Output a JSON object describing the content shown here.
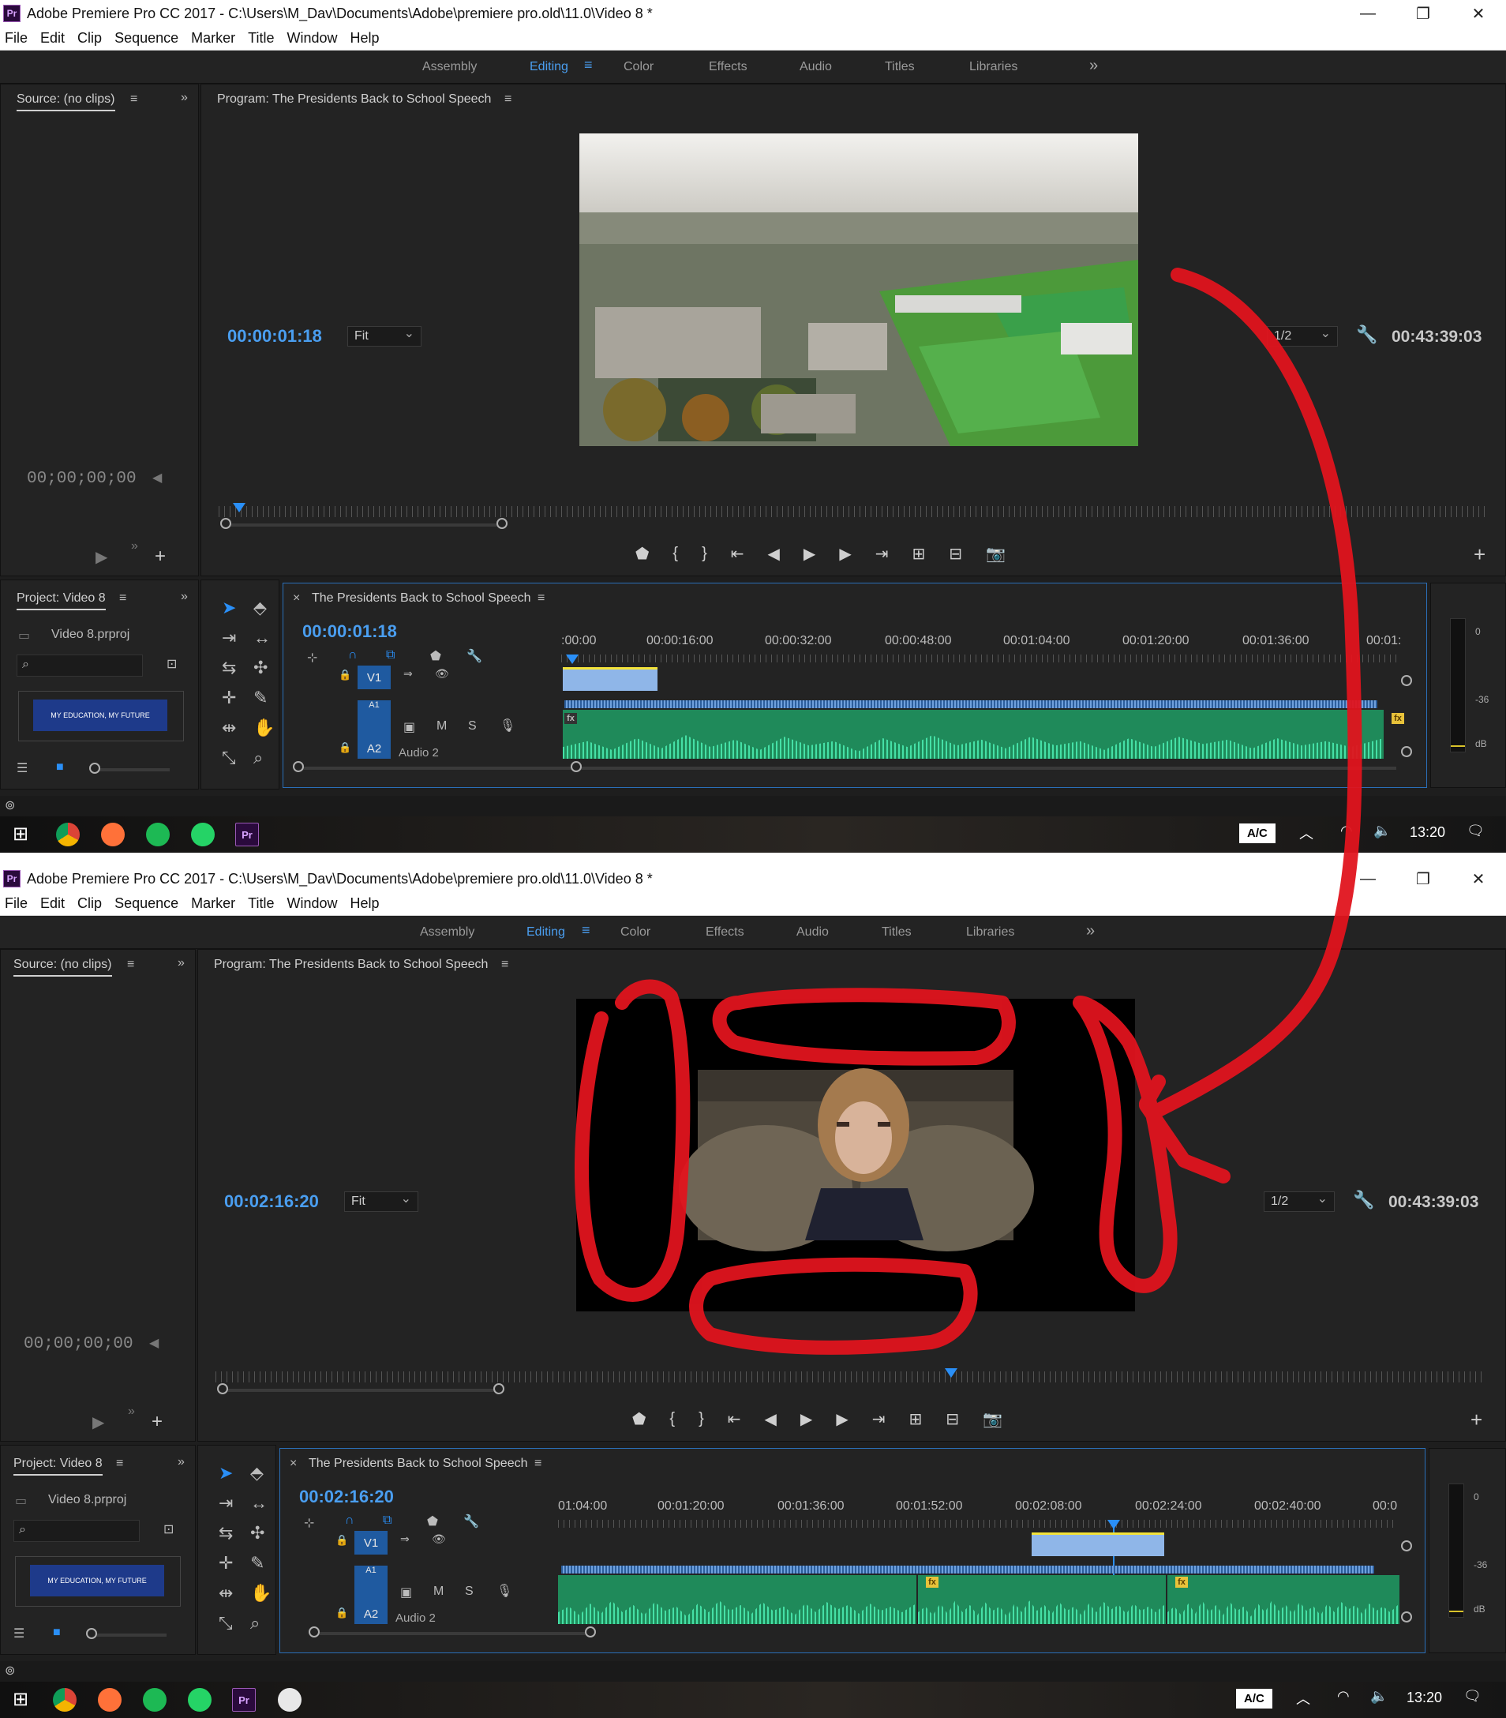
{
  "window_title": "Adobe Premiere Pro CC 2017 - C:\\Users\\M_Dav\\Documents\\Adobe\\premiere pro.old\\11.0\\Video 8 *",
  "app_icon_label": "Pr",
  "window_controls": {
    "minimize": "—",
    "maximize": "❐",
    "close": "✕"
  },
  "menu": [
    "File",
    "Edit",
    "Clip",
    "Sequence",
    "Marker",
    "Title",
    "Window",
    "Help"
  ],
  "workspaces": [
    "Assembly",
    "Editing",
    "Color",
    "Effects",
    "Audio",
    "Titles",
    "Libraries"
  ],
  "active_workspace": "Editing",
  "workspace_more": "»",
  "source_panel": {
    "tab": "Source: (no clips)",
    "timecode": "00;00;00;00"
  },
  "program_panel": {
    "tab": "Program: The Presidents Back to School Speech",
    "fit": "Fit",
    "resolution": "1/2",
    "duration": "00:43:39:03"
  },
  "project_panel": {
    "tab": "Project: Video 8",
    "file": "Video 8.prproj",
    "thumb_text": "MY EDUCATION, MY FUTURE"
  },
  "timeline": {
    "tab": "The Presidents Back to School Speech",
    "tracks": {
      "video": "V1",
      "audio_top": "A1",
      "audio": "A2",
      "audio_name": "Audio 2",
      "mute": "M",
      "solo": "S"
    }
  },
  "meter": {
    "zero": "0",
    "minus36": "-36",
    "db": "dB"
  },
  "screens": [
    {
      "program_timecode": "00:00:01:18",
      "timeline_timecode": "00:00:01:18",
      "ruler": [
        ":00:00",
        "00:00:16:00",
        "00:00:32:00",
        "00:00:48:00",
        "00:01:04:00",
        "00:01:20:00",
        "00:01:36:00",
        "00:01:"
      ]
    },
    {
      "program_timecode": "00:02:16:20",
      "timeline_timecode": "00:02:16:20",
      "ruler": [
        "01:04:00",
        "00:01:20:00",
        "00:01:36:00",
        "00:01:52:00",
        "00:02:08:00",
        "00:02:24:00",
        "00:02:40:00",
        "00:0"
      ]
    }
  ],
  "taskbar": {
    "ac": "A/C",
    "clock": "13:20"
  },
  "colors": {
    "accent": "#2a8ff7",
    "panel": "#232323",
    "annotation": "#e0141e"
  }
}
